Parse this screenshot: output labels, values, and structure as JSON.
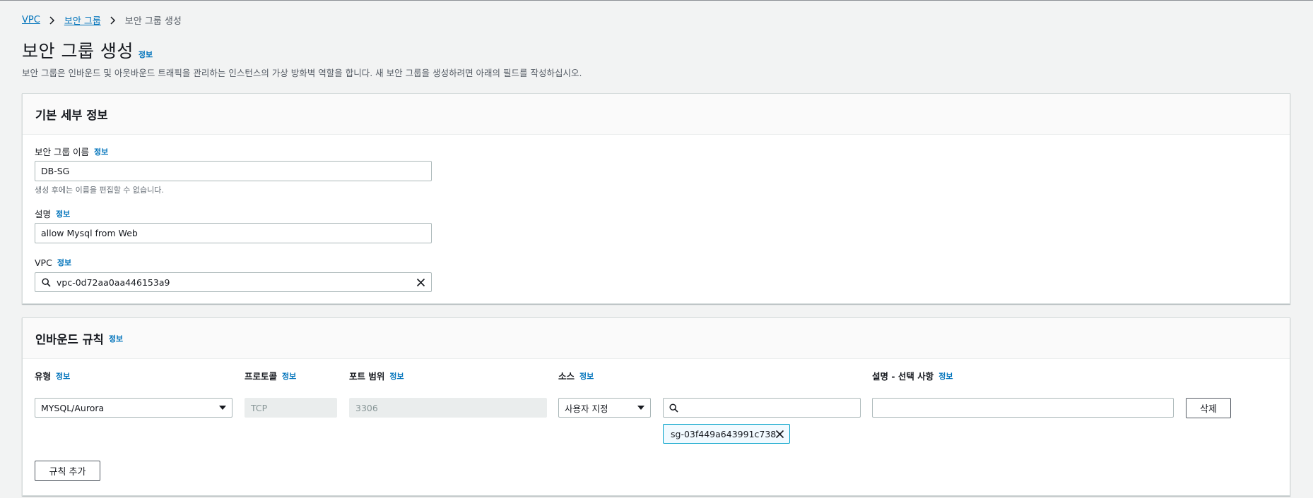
{
  "breadcrumb": {
    "vpc": "VPC",
    "security_groups": "보안 그룹",
    "current": "보안 그룹 생성"
  },
  "page": {
    "title": "보안 그룹 생성",
    "info": "정보",
    "description": "보안 그룹은 인바운드 및 아웃바운드 트래픽을 관리하는 인스턴스의 가상 방화벽 역할을 합니다. 새 보안 그룹을 생성하려면 아래의 필드를 작성하십시오."
  },
  "basic": {
    "title": "기본 세부 정보",
    "name_label": "보안 그룹 이름",
    "name_value": "DB-SG",
    "name_hint": "생성 후에는 이름을 편집할 수 없습니다.",
    "desc_label": "설명",
    "desc_value": "allow Mysql from Web",
    "vpc_label": "VPC",
    "vpc_value": "vpc-0d72aa0aa446153a9"
  },
  "inbound": {
    "title": "인바운드 규칙",
    "columns": {
      "type": "유형",
      "protocol": "프로토콜",
      "port": "포트 범위",
      "source": "소스",
      "description": "설명 - 선택 사항"
    },
    "rule": {
      "type": "MYSQL/Aurora",
      "protocol": "TCP",
      "port": "3306",
      "source_type": "사용자 지정",
      "source_search": "",
      "source_token": "sg-03f449a643991c738",
      "description": "",
      "delete_label": "삭제"
    },
    "add_rule_label": "규칙 추가"
  },
  "icons": [
    "chevron-right-icon",
    "search-icon",
    "close-icon",
    "caret-down-icon"
  ],
  "colors": {
    "link": "#0073bb",
    "background": "#f2f3f3",
    "token_border": "#00a1c9"
  }
}
